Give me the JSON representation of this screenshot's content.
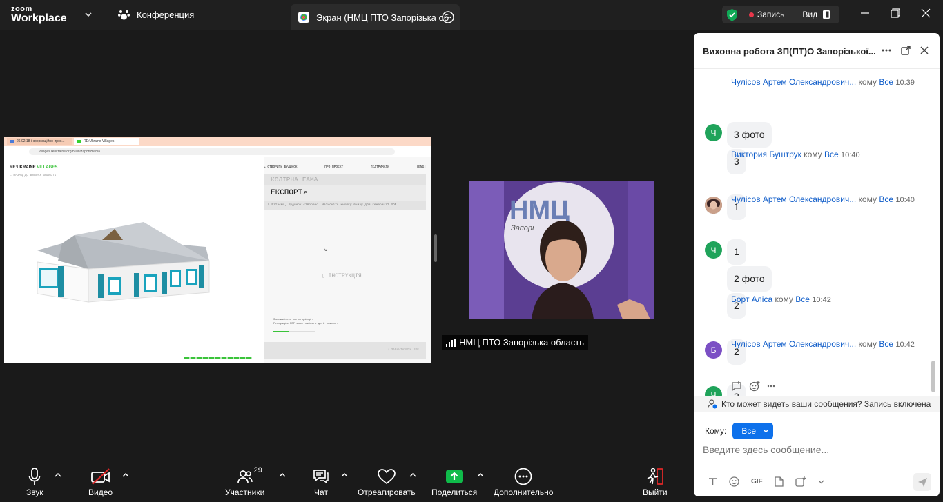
{
  "topbar": {
    "logo_small": "zoom",
    "logo_big": "Workplace",
    "conference_label": "Конференция",
    "screen_tab_label": "Экран (НМЦ ПТО Запорізька об",
    "record_label": "Запись",
    "view_label": "Вид",
    "record_color": "#e8374b",
    "shield_color": "#0fa956"
  },
  "shared_screen": {
    "browser_tabs": [
      "26.02.18 інформаційно-прос...",
      "RE:Ukraine Villages"
    ],
    "url": "villages.reukraine.org/build/zaporizhzhia",
    "site_logo_re": "RE:UKRAINE ",
    "site_logo_villages": "VILLAGES",
    "back_link": "← НАЗАД ДО ВИБОРУ ОБЛАСТІ",
    "nav": [
      "↳ СТВОРИТИ БУДИНОК",
      "ПРО ПРОЄКТ",
      "ПІДТРИМАТИ",
      "[ENG]"
    ],
    "palette_label": "КОЛІРНА ГАМА",
    "export_label": "ЕКСПОРТ↗",
    "notice": "↳ Вітаємо, Будинок створено. Натисніть кнопку внизу для генерації PDF.",
    "instruction": "ІНСТРУКЦІЯ",
    "loading_line1": "Залишайтеся на сторінці.",
    "loading_line2": "Генерація PDF може зайняти до 2 хвилин.",
    "download": "↓ ЗАВАНТАЖИТИ PDF"
  },
  "video": {
    "participant_name": "НМЦ ПТО Запорізька область",
    "sign_text": "НМЦ",
    "sign_sub": "Запорі"
  },
  "chat": {
    "title": "Виховна робота ЗП(ПТ)О Запорізької...",
    "messages": [
      {
        "sender": "Чулісов Артем Олександрович...",
        "to_word": "кому",
        "audience": "Все",
        "time": "10:39",
        "initial": "Ч",
        "avatar_color": "#1fa35a",
        "bubbles": [
          "3 фото",
          "3"
        ]
      },
      {
        "sender": "Виктория Буштрук",
        "to_word": "кому",
        "audience": "Все",
        "time": "10:40",
        "initial": "",
        "avatar_color": "#7a5a4a",
        "bubbles": [
          "1"
        ]
      },
      {
        "sender": "Чулісов Артем Олександрович...",
        "to_word": "кому",
        "audience": "Все",
        "time": "10:40",
        "initial": "Ч",
        "avatar_color": "#1fa35a",
        "bubbles": [
          "1",
          "2 фото",
          "2"
        ]
      },
      {
        "sender": "Борт Аліса",
        "to_word": "кому",
        "audience": "Все",
        "time": "10:42",
        "initial": "Б",
        "avatar_color": "#7b4fc4",
        "bubbles": [
          "2"
        ]
      },
      {
        "sender": "Чулісов Артем Олександрович...",
        "to_word": "кому",
        "audience": "Все",
        "time": "10:42",
        "initial": "Ч",
        "avatar_color": "#1fa35a",
        "bubbles": [
          "2"
        ]
      }
    ],
    "privacy_text": "Кто может видеть ваши сообщения? Запись включена",
    "to_label": "Кому:",
    "to_value": "Все",
    "input_placeholder": "Введите здесь сообщение...",
    "gif_label": "GIF"
  },
  "toolbar": {
    "audio": "Звук",
    "video": "Видео",
    "participants": "Участники",
    "participants_count": "29",
    "chat": "Чат",
    "react": "Отреагировать",
    "share": "Поделиться",
    "more": "Дополнительно",
    "leave": "Выйти",
    "share_color": "#0fbb4a",
    "leave_color": "#e02828"
  }
}
